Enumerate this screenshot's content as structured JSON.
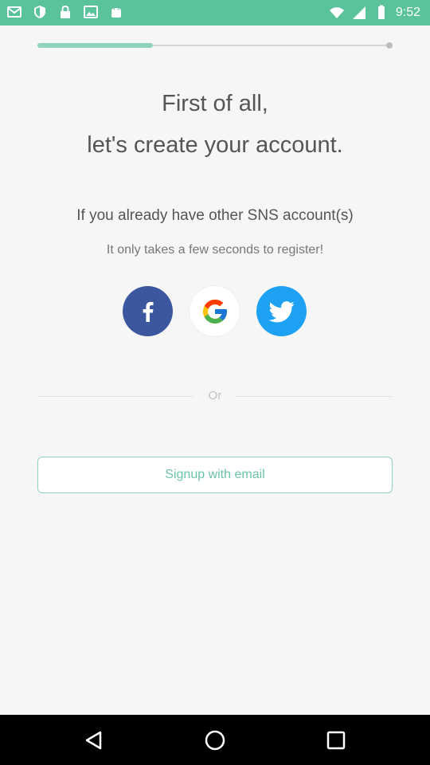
{
  "status_bar": {
    "time": "9:52",
    "icons_left": [
      "gmail-icon",
      "shield-icon",
      "lock-icon",
      "image-icon",
      "android-icon"
    ],
    "icons_right": [
      "wifi-icon",
      "signal-icon",
      "battery-icon"
    ],
    "color": "#5ac39b"
  },
  "progress": {
    "value": 0.33,
    "fill_color": "#8fd3b9"
  },
  "headline": {
    "line1": "First of all,",
    "line2": "let's create your account."
  },
  "sns_section": {
    "title": "If you already have other SNS account(s)",
    "subtitle": "It only takes a few seconds to register!",
    "buttons": [
      {
        "name": "facebook",
        "icon": "facebook-icon",
        "color": "#3b579d"
      },
      {
        "name": "google",
        "icon": "google-icon",
        "color": "#ffffff"
      },
      {
        "name": "twitter",
        "icon": "twitter-icon",
        "color": "#1da1f2"
      }
    ]
  },
  "divider": {
    "label": "Or"
  },
  "email_signup": {
    "label": "Signup with email",
    "accent": "#6cc4a6"
  },
  "nav_bar": {
    "buttons": [
      "back-icon",
      "home-icon",
      "recent-apps-icon"
    ]
  }
}
